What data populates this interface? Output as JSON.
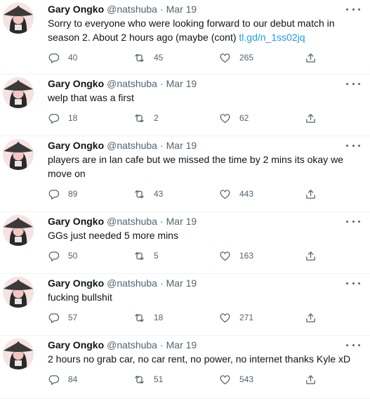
{
  "tweets": [
    {
      "name": "Gary Ongko",
      "handle": "@natshuba",
      "date": "Mar 19",
      "text": "Sorry to everyone who were looking forward to our debut match in season 2. About 2 hours ago (maybe (cont) ",
      "link": "tl.gd/n_1ss02jq",
      "replies": "40",
      "retweets": "45",
      "likes": "265"
    },
    {
      "name": "Gary Ongko",
      "handle": "@natshuba",
      "date": "Mar 19",
      "text": "welp that was a first",
      "link": "",
      "replies": "18",
      "retweets": "2",
      "likes": "62"
    },
    {
      "name": "Gary Ongko",
      "handle": "@natshuba",
      "date": "Mar 19",
      "text": "players are in lan cafe but we missed the time by 2 mins its okay we move on",
      "link": "",
      "replies": "89",
      "retweets": "43",
      "likes": "443"
    },
    {
      "name": "Gary Ongko",
      "handle": "@natshuba",
      "date": "Mar 19",
      "text": "GGs just needed 5 more mins",
      "link": "",
      "replies": "50",
      "retweets": "5",
      "likes": "163"
    },
    {
      "name": "Gary Ongko",
      "handle": "@natshuba",
      "date": "Mar 19",
      "text": "fucking bullshit",
      "link": "",
      "replies": "57",
      "retweets": "18",
      "likes": "271"
    },
    {
      "name": "Gary Ongko",
      "handle": "@natshuba",
      "date": "Mar 19",
      "text": "2 hours no grab car, no car rent, no power, no internet thanks Kyle xD",
      "link": "",
      "replies": "84",
      "retweets": "51",
      "likes": "543"
    }
  ],
  "separator": "·",
  "icons": {
    "avatar": "conical-hat-avatar-icon",
    "more": "more-dots-icon",
    "reply": "reply-bubble-icon",
    "retweet": "retweet-icon",
    "like": "heart-icon",
    "share": "share-icon"
  },
  "colors": {
    "text": "#0f1419",
    "secondary": "#536471",
    "link": "#1d9bf0",
    "divider": "#eff3f4"
  }
}
